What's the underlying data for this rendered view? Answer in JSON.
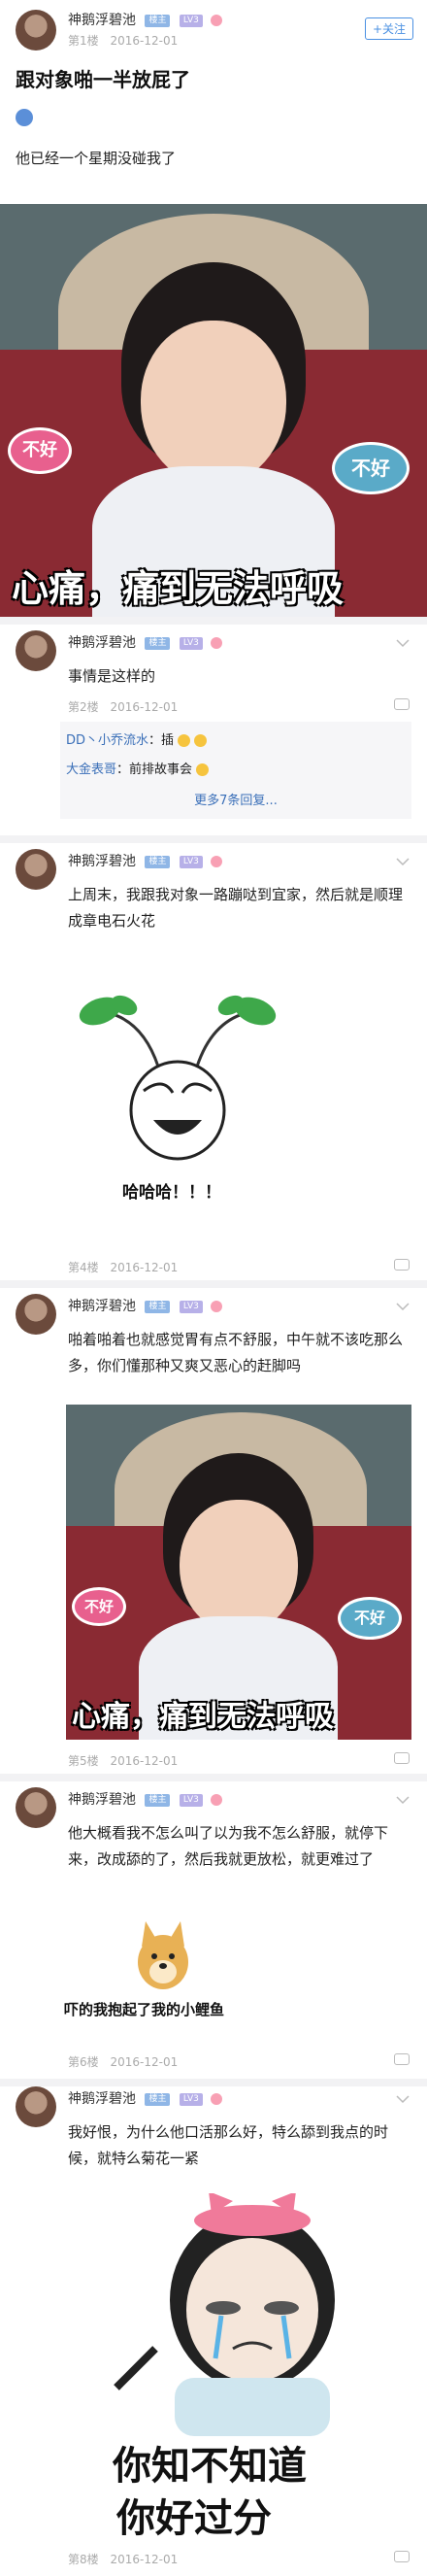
{
  "op": {
    "username": "神鹅浮碧池",
    "badge1": "楼主",
    "badge2": "LV3",
    "floor": "第1楼",
    "date": "2016-12-01",
    "follow_label": "+关注",
    "title": "跟对象啪一半放屁了",
    "body": "他已经一个星期没碰我了"
  },
  "meme1": {
    "left_bubble": "不好",
    "right_bubble": "不好",
    "caption": "心痛，痛到无法呼吸"
  },
  "post2": {
    "username": "神鹅浮碧池",
    "badge1": "楼主",
    "badge2": "LV3",
    "text": "事情是这样的",
    "floor": "第2楼",
    "date": "2016-12-01",
    "replies": [
      {
        "user": "DD丶小乔流水",
        "text": "：插"
      },
      {
        "user": "大金表哥",
        "text": "：前排故事会"
      }
    ],
    "more": "更多7条回复..."
  },
  "post3": {
    "username": "神鹅浮碧池",
    "badge1": "楼主",
    "badge2": "LV3",
    "text": "上周末，我跟我对象一路蹦哒到宜家，然后就是顺理成章电石火花",
    "meme_caption": "哈哈哈！！！",
    "floor": "第4楼",
    "date": "2016-12-01"
  },
  "post4": {
    "username": "神鹅浮碧池",
    "badge1": "楼主",
    "badge2": "LV3",
    "text": "啪着啪着也就感觉胃有点不舒服，中午就不该吃那么多，你们懂那种又爽又恶心的赶脚吗",
    "floor": "第5楼",
    "date": "2016-12-01"
  },
  "meme2": {
    "left_bubble": "不好",
    "right_bubble": "不好",
    "caption": "心痛，痛到无法呼吸"
  },
  "post5": {
    "username": "神鹅浮碧池",
    "badge1": "楼主",
    "badge2": "LV3",
    "text": "他大概看我不怎么叫了以为我不怎么舒服，就停下来，改成舔的了，然后我就更放松，就更难过了",
    "meme_caption": "吓的我抱起了我的小鲤鱼",
    "floor": "第6楼",
    "date": "2016-12-01"
  },
  "post6": {
    "username": "神鹅浮碧池",
    "badge1": "楼主",
    "badge2": "LV3",
    "text": "我好恨，为什么他口活那么好，特么舔到我点的时候，就特么菊花一紧",
    "meme_line1": "你知不知道",
    "meme_line2": "你好过分",
    "floor": "第8楼",
    "date": "2016-12-01"
  }
}
